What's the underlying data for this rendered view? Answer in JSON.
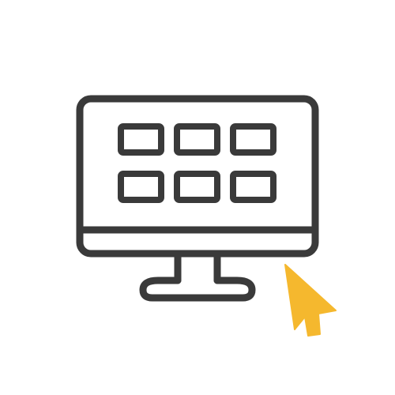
{
  "illustration": {
    "subject": "monitor-icon",
    "pointer": "cursor-arrow-icon",
    "grid": {
      "rows": 2,
      "columns": 3
    }
  },
  "colors": {
    "background": "#ffffff",
    "outline": "#3a3a3a",
    "cursor": "#f5b82e"
  }
}
